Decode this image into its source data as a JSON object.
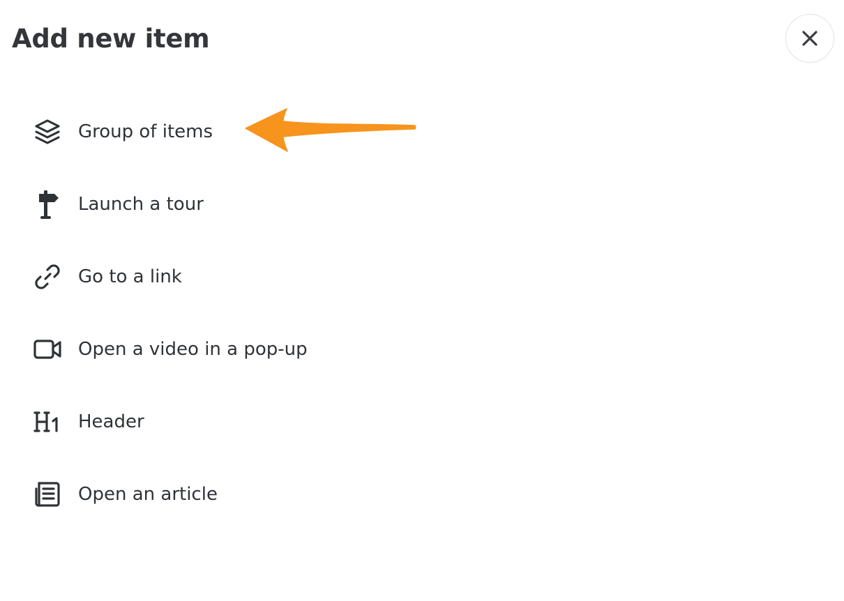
{
  "dialog": {
    "title": "Add new item",
    "close_icon": "close-icon"
  },
  "menu": {
    "items": [
      {
        "label": "Group of items",
        "icon": "layers-icon"
      },
      {
        "label": "Launch a tour",
        "icon": "signpost-icon"
      },
      {
        "label": "Go to a link",
        "icon": "link-icon"
      },
      {
        "label": "Open a video in a pop-up",
        "icon": "video-camera-icon"
      },
      {
        "label": "Header",
        "icon": "heading-h1-icon"
      },
      {
        "label": "Open an article",
        "icon": "article-icon"
      }
    ]
  },
  "annotation": {
    "arrow_color": "#F7941D",
    "arrow_target": "Group of items"
  },
  "colors": {
    "text": "#2f3237",
    "icon": "#2f3237",
    "close_border": "#e2e3e6"
  }
}
